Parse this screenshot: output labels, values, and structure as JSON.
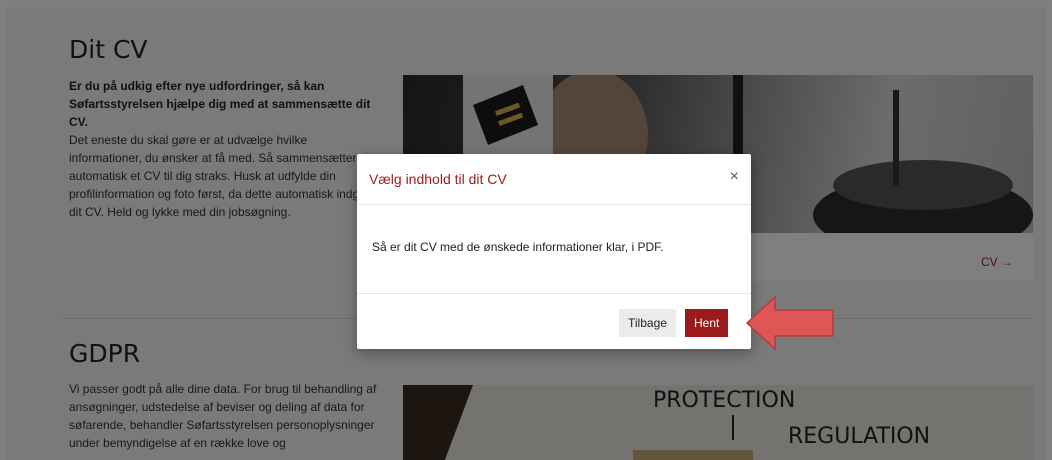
{
  "cv_section": {
    "title": "Dit CV",
    "lead": "Er du på udkig efter nye udfordringer, så kan Søfartsstyrelsen hjælpe dig med at sammensætte dit CV.",
    "body": "Det eneste du skal gøre er at udvælge hvilke informationer, du ønsker at få med. Så sammensætter vi automatisk et CV til dig straks. Husk at udfylde din profilinformation og foto først, da dette automatisk indgår i dit CV. Held og lykke med din jobsøgning.",
    "link_label": "CV →"
  },
  "gdpr_section": {
    "title": "GDPR",
    "body": "Vi passer godt på alle dine data. For brug til behandling af ansøgninger, udstedelse af beviser og deling af data for søfarende, behandler Søfartsstyrelsen personoplysninger under bemyndigelse af en række love og",
    "image_words": [
      "PROTECTION",
      "REGULATION"
    ]
  },
  "modal": {
    "title": "Vælg indhold til dit CV",
    "close": "×",
    "message": "Så er dit CV med de ønskede informationer klar, i PDF.",
    "back_label": "Tilbage",
    "get_label": "Hent"
  },
  "colors": {
    "accent": "#9b1b1b",
    "arrow": "#e05555",
    "overlay": "rgba(0,0,0,0.5)"
  },
  "icons": [
    "close-icon",
    "arrow-right-icon",
    "pointer-arrow-icon"
  ]
}
